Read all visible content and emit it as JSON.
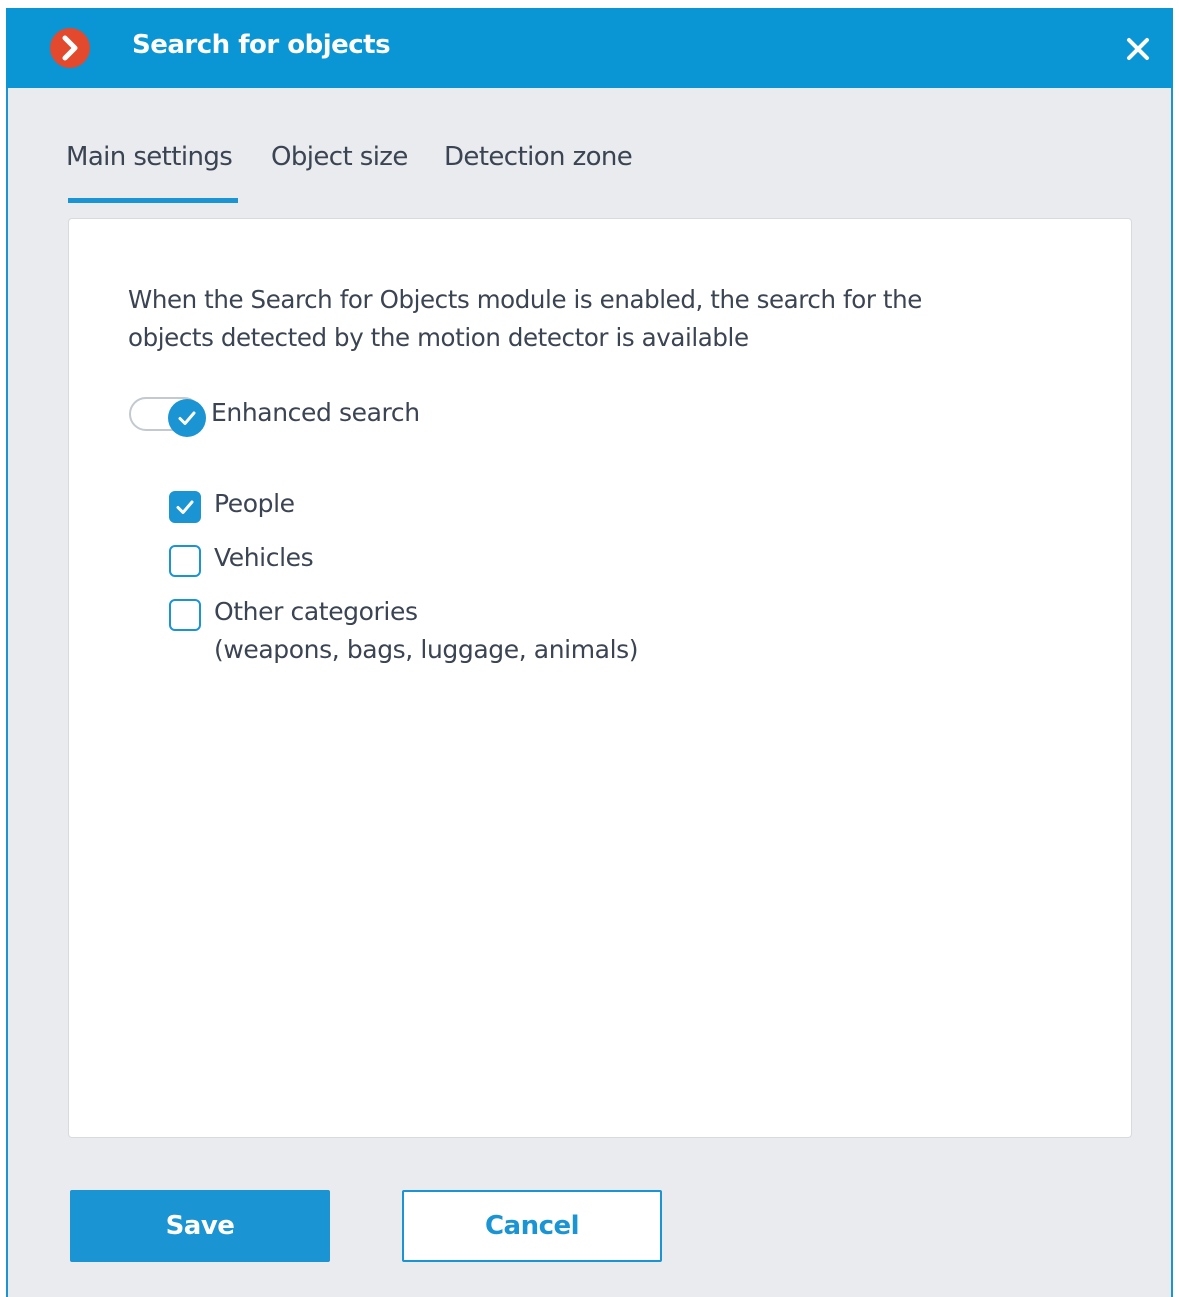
{
  "window": {
    "title": "Search for objects",
    "logo_icon": "app-logo-chevron-icon",
    "close_icon": "close-icon",
    "accent_color": "#0a96d4",
    "logo_color": "#e2492d"
  },
  "tabs": [
    {
      "label": "Main settings",
      "active": true
    },
    {
      "label": "Object size",
      "active": false
    },
    {
      "label": "Detection zone",
      "active": false
    }
  ],
  "main": {
    "description_line1": "When the Search for Objects module is enabled, the search for the",
    "description_line2": "objects detected by the motion detector is available",
    "enhanced_search": {
      "label": "Enhanced search",
      "enabled": true
    },
    "categories": [
      {
        "label": "People",
        "checked": true
      },
      {
        "label": "Vehicles",
        "checked": false
      },
      {
        "label": "Other categories",
        "sublabel": "(weapons, bags, luggage, animals)",
        "checked": false
      }
    ]
  },
  "footer": {
    "save_label": "Save",
    "cancel_label": "Cancel"
  }
}
